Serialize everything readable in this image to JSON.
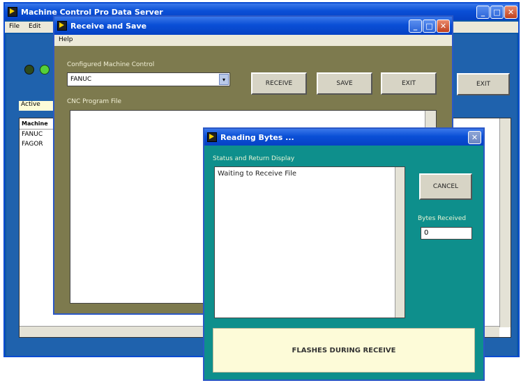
{
  "back_window": {
    "title": "Machine Control Pro Data Server",
    "menu": [
      "File",
      "Edit"
    ],
    "tab_label": "Active",
    "table_header": "Machine",
    "table_rows": [
      "FANUC",
      "FAGOR"
    ],
    "exit_label": "EXIT",
    "status_led_colors": [
      "#2c4a1c",
      "#55d03a"
    ]
  },
  "middle_window": {
    "title": "Receive and Save",
    "menu": [
      "Help"
    ],
    "control_label": "Configured Machine Control",
    "control_value": "FANUC",
    "program_label": "CNC Program File",
    "buttons": {
      "receive": "RECEIVE",
      "save": "SAVE",
      "exit": "EXIT"
    }
  },
  "dialog": {
    "title": "Reading Bytes ...",
    "status_label": "Status and Return Display",
    "status_text": "Waiting to Receive File",
    "cancel_label": "CANCEL",
    "bytes_label": "Bytes Received",
    "bytes_value": "0",
    "banner_text": "FLASHES DURING RECEIVE"
  },
  "colors": {
    "title_bar": "#0a4fd6",
    "window_olive": "#7d7a4e",
    "dialog_teal": "#0e8f8c",
    "banner_bg": "#fdfbd8"
  }
}
